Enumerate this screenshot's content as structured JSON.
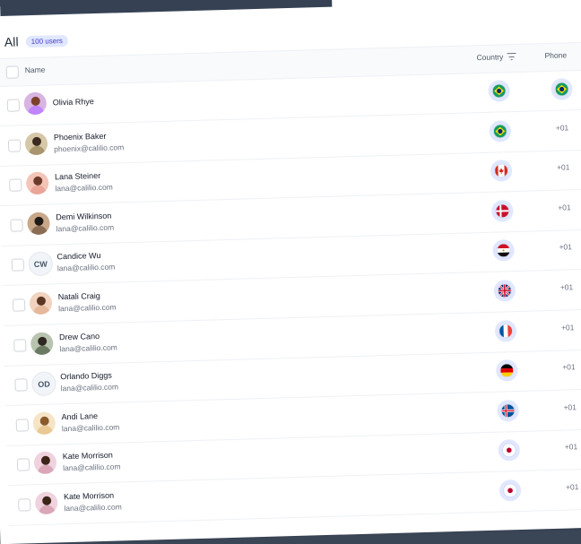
{
  "header": {
    "title": "All",
    "badge": "100 users"
  },
  "columns": {
    "name": "Name",
    "country": "Country",
    "phone": "Phone"
  },
  "rows": [
    {
      "name": "Olivia Rhye",
      "email": "",
      "initials": "",
      "avatar": "photo",
      "flag": "br",
      "phone": ""
    },
    {
      "name": "Phoenix Baker",
      "email": "phoenix@calilio.com",
      "initials": "",
      "avatar": "photo",
      "flag": "br",
      "phone": "+01"
    },
    {
      "name": "Lana Steiner",
      "email": "lana@calilio.com",
      "initials": "",
      "avatar": "photo",
      "flag": "ca",
      "phone": "+01"
    },
    {
      "name": "Demi Wilkinson",
      "email": "lana@calilio.com",
      "initials": "",
      "avatar": "photo",
      "flag": "dk",
      "phone": "+01"
    },
    {
      "name": "Candice Wu",
      "email": "lana@calilio.com",
      "initials": "CW",
      "avatar": "initials",
      "flag": "eg",
      "phone": "+01"
    },
    {
      "name": "Natali Craig",
      "email": "lana@calilio.com",
      "initials": "",
      "avatar": "photo",
      "flag": "gb",
      "phone": "+01"
    },
    {
      "name": "Drew Cano",
      "email": "lana@calilio.com",
      "initials": "",
      "avatar": "photo",
      "flag": "fr",
      "phone": "+01"
    },
    {
      "name": "Orlando Diggs",
      "email": "lana@calilio.com",
      "initials": "OD",
      "avatar": "initials",
      "flag": "de",
      "phone": "+01"
    },
    {
      "name": "Andi Lane",
      "email": "lana@calilio.com",
      "initials": "",
      "avatar": "photo",
      "flag": "is",
      "phone": "+01"
    },
    {
      "name": "Kate Morrison",
      "email": "lana@calilio.com",
      "initials": "",
      "avatar": "photo",
      "flag": "jp",
      "phone": "+01"
    },
    {
      "name": "Kate Morrison",
      "email": "lana@calilio.com",
      "initials": "",
      "avatar": "photo",
      "flag": "jp",
      "phone": "+01"
    }
  ],
  "colors": {
    "badge_bg": "#e0e7ff",
    "badge_text": "#4338ca",
    "flag_ring": "#e0e7ff",
    "frame": "#364254"
  }
}
